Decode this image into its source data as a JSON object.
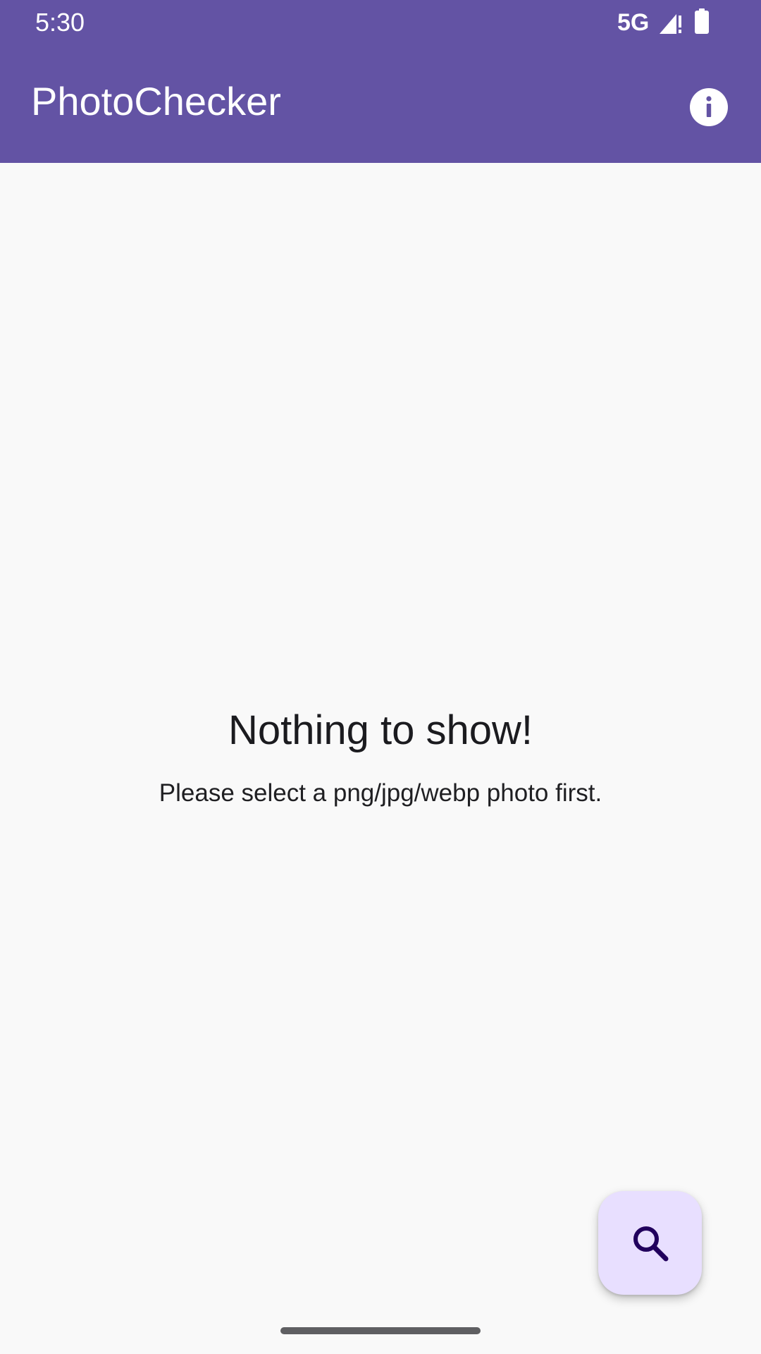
{
  "status_bar": {
    "time": "5:30",
    "network": "5G",
    "signal_icon": "signal-alert-icon",
    "battery_icon": "battery-full-icon"
  },
  "app_bar": {
    "title": "PhotoChecker",
    "info_icon": "info-icon"
  },
  "empty_state": {
    "title": "Nothing to show!",
    "subtitle": "Please select a png/jpg/webp photo first."
  },
  "fab": {
    "icon": "search-icon"
  },
  "colors": {
    "primary": "#6353a4",
    "background": "#f9f9f9",
    "fab_container": "#e8dfff",
    "fab_icon": "#21005d",
    "on_primary": "#ffffff",
    "text": "#1b1b1f"
  }
}
